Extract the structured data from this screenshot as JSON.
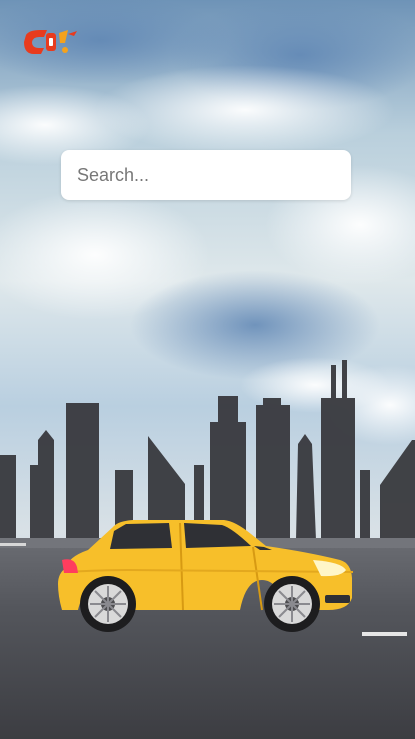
{
  "app": {
    "logo_icon": "cab-logo-icon",
    "colors": {
      "logo_red": "#e83b1e",
      "logo_orange": "#f4a21d",
      "car_yellow": "#f7bf2a"
    }
  },
  "search": {
    "placeholder": "Search...",
    "value": ""
  },
  "scene": {
    "background_icon": "city-skyline-road-background",
    "car_icon": "yellow-car-icon"
  }
}
